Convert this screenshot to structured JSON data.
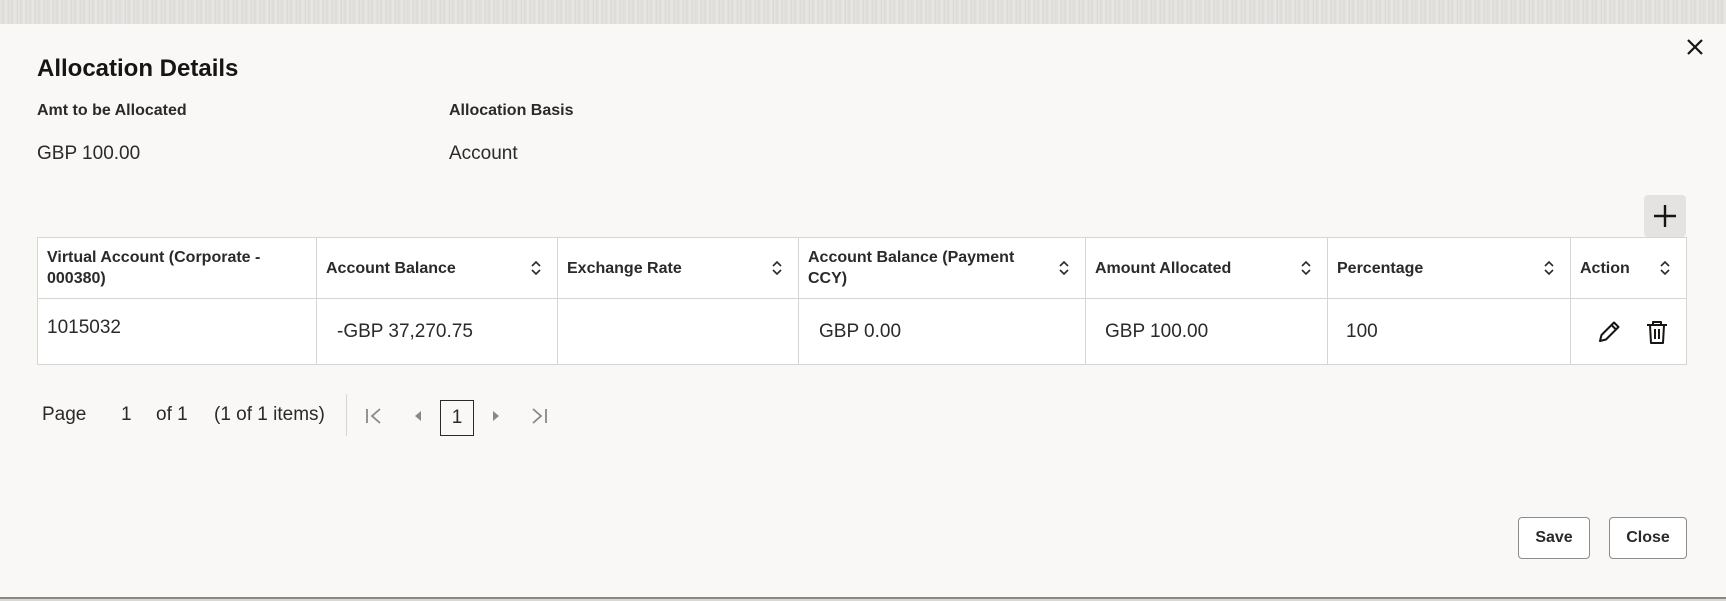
{
  "dialog": {
    "title": "Allocation Details",
    "close_icon": "close-icon"
  },
  "fields": {
    "amt_label": "Amt to be Allocated",
    "amt_value": "GBP 100.00",
    "basis_label": "Allocation Basis",
    "basis_value": "Account"
  },
  "table": {
    "columns": [
      "Virtual Account (Corporate - 000380)",
      "Account Balance",
      "Exchange Rate",
      "Account Balance (Payment CCY)",
      "Amount Allocated",
      "Percentage",
      "Action"
    ],
    "rows": [
      {
        "virtual_account": "1015032",
        "account_balance": "-GBP 37,270.75",
        "exchange_rate": "",
        "account_balance_payment_ccy": "GBP 0.00",
        "amount_allocated": "GBP 100.00",
        "percentage": "100"
      }
    ]
  },
  "pager": {
    "page_label": "Page",
    "page_number": "1",
    "of_label": "of 1",
    "items_label": "(1 of 1 items)",
    "current_page": "1"
  },
  "buttons": {
    "save": "Save",
    "close": "Close"
  },
  "icons": {
    "add": "plus-icon",
    "sort": "sort-icon",
    "edit": "pencil-icon",
    "delete": "trash-icon",
    "first": "first-page-icon",
    "prev": "previous-page-icon",
    "next": "next-page-icon",
    "last": "last-page-icon"
  }
}
